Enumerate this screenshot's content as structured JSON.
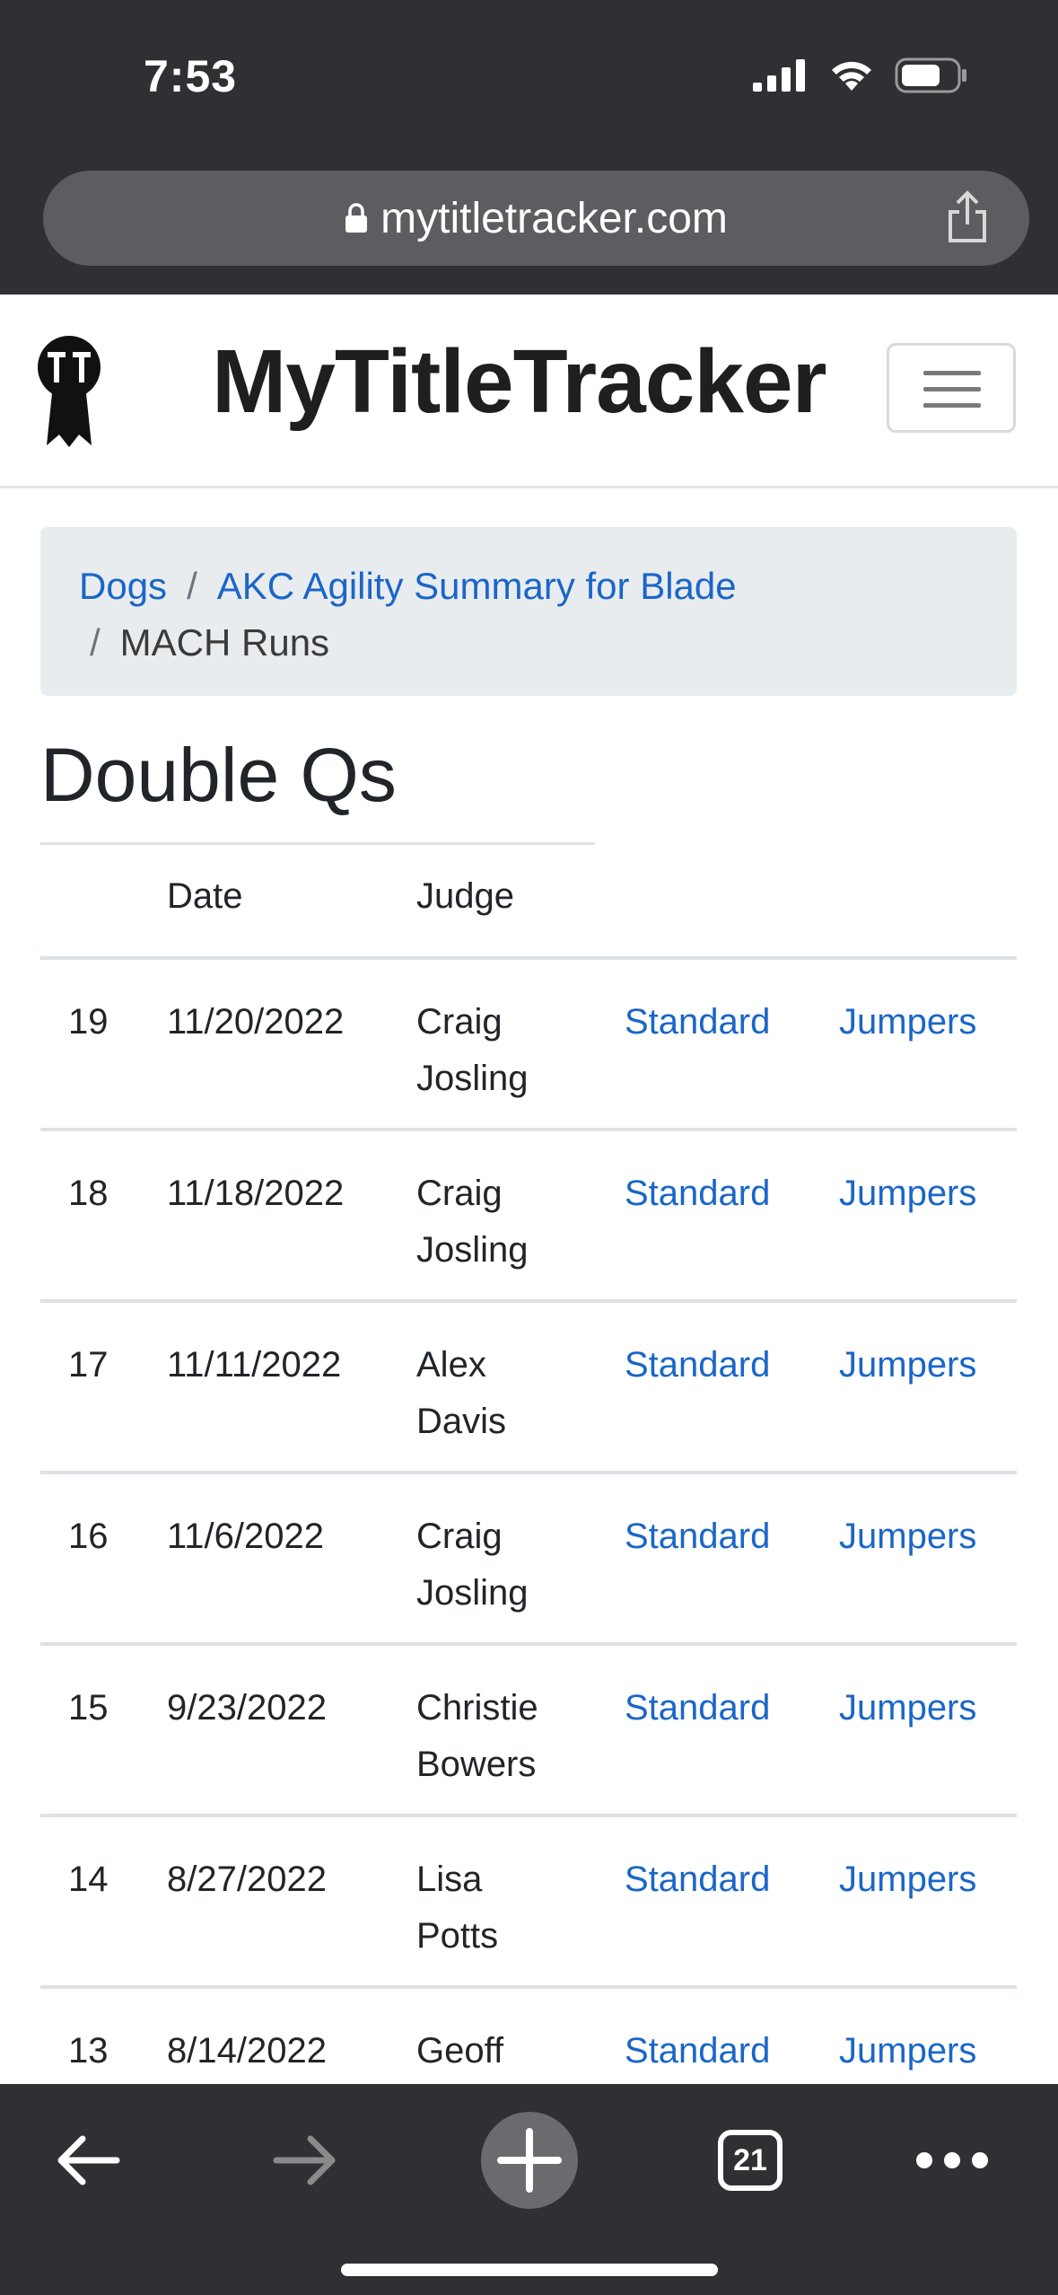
{
  "status_bar": {
    "time": "7:53"
  },
  "browser": {
    "url": "mytitletracker.com",
    "tab_count": "21"
  },
  "navbar": {
    "brand": "MyTitleTracker"
  },
  "breadcrumb": {
    "items": [
      {
        "label": "Dogs"
      },
      {
        "label": "AKC Agility Summary for Blade"
      },
      {
        "label": "MACH Runs"
      }
    ]
  },
  "page": {
    "title": "Double Qs"
  },
  "table": {
    "headers": [
      "",
      "Date",
      "Judge",
      "",
      ""
    ],
    "rows": [
      {
        "num": "19",
        "date": "11/20/2022",
        "judge": "Craig Josling",
        "standard": "Standard",
        "jumpers": "Jumpers"
      },
      {
        "num": "18",
        "date": "11/18/2022",
        "judge": "Craig Josling",
        "standard": "Standard",
        "jumpers": "Jumpers"
      },
      {
        "num": "17",
        "date": "11/11/2022",
        "judge": "Alex Davis",
        "standard": "Standard",
        "jumpers": "Jumpers"
      },
      {
        "num": "16",
        "date": "11/6/2022",
        "judge": "Craig Josling",
        "standard": "Standard",
        "jumpers": "Jumpers"
      },
      {
        "num": "15",
        "date": "9/23/2022",
        "judge": "Christie Bowers",
        "standard": "Standard",
        "jumpers": "Jumpers"
      },
      {
        "num": "14",
        "date": "8/27/2022",
        "judge": "Lisa Potts",
        "standard": "Standard",
        "jumpers": "Jumpers"
      },
      {
        "num": "13",
        "date": "8/14/2022",
        "judge": "Geoff",
        "standard": "Standard",
        "jumpers": "Jumpers"
      }
    ]
  },
  "colors": {
    "link": "#1a66c8",
    "chrome": "#2f3033",
    "breadcrumb_bg": "#e9ecef"
  },
  "icons": [
    "signal-icon",
    "wifi-icon",
    "battery-icon",
    "lock-icon",
    "share-icon",
    "brand-logo-icon",
    "menu-icon",
    "back-icon",
    "forward-icon",
    "new-tab-icon",
    "tabs-icon",
    "more-icon"
  ]
}
